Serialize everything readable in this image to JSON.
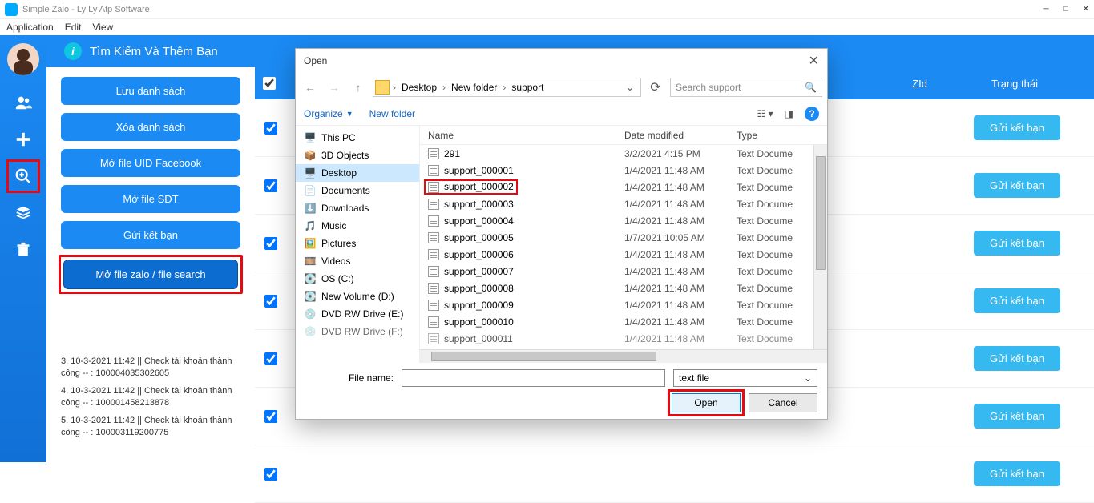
{
  "window": {
    "title": "Simple Zalo - Ly Ly Atp Software",
    "menu": {
      "application": "Application",
      "edit": "Edit",
      "view": "View"
    }
  },
  "banner": {
    "title": "Tìm Kiếm Và Thêm Bạn"
  },
  "buttons": {
    "save_list": "Lưu danh sách",
    "delete_list": "Xóa danh sách",
    "open_uid_fb": "Mở file UID Facebook",
    "open_sdt": "Mở file SĐT",
    "send_friend": "Gửi kết bạn",
    "open_file_search": "Mở file zalo / file search"
  },
  "log": {
    "e1": "3. 10-3-2021  11:42 || Check tài khoản thành công  -- : 100004035302605",
    "e2": "4. 10-3-2021  11:42 || Check tài khoản thành công  -- : 100001458213878",
    "e3": "5. 10-3-2021  11:42 || Check tài khoản thành công  -- : 100003119200775"
  },
  "table": {
    "col_zid": "ZId",
    "col_status": "Trạng thái",
    "action": "Gửi kết bạn"
  },
  "dialog": {
    "title": "Open",
    "crumbs": {
      "c1": "Desktop",
      "c2": "New folder",
      "c3": "support"
    },
    "search_placeholder": "Search support",
    "organize": "Organize",
    "new_folder": "New folder",
    "tree": {
      "this_pc": "This PC",
      "objects3d": "3D Objects",
      "desktop": "Desktop",
      "documents": "Documents",
      "downloads": "Downloads",
      "music": "Music",
      "pictures": "Pictures",
      "videos": "Videos",
      "os_c": "OS (C:)",
      "new_vol": "New Volume (D:)",
      "dvd_e": "DVD RW Drive (E:)",
      "dvd_f": "DVD RW Drive (F:)"
    },
    "cols": {
      "name": "Name",
      "date": "Date modified",
      "type": "Type"
    },
    "files": {
      "f0": {
        "n": "291",
        "d": "3/2/2021 4:15 PM",
        "t": "Text Docume"
      },
      "f1": {
        "n": "support_000001",
        "d": "1/4/2021 11:48 AM",
        "t": "Text Docume"
      },
      "f2": {
        "n": "support_000002",
        "d": "1/4/2021 11:48 AM",
        "t": "Text Docume"
      },
      "f3": {
        "n": "support_000003",
        "d": "1/4/2021 11:48 AM",
        "t": "Text Docume"
      },
      "f4": {
        "n": "support_000004",
        "d": "1/4/2021 11:48 AM",
        "t": "Text Docume"
      },
      "f5": {
        "n": "support_000005",
        "d": "1/7/2021 10:05 AM",
        "t": "Text Docume"
      },
      "f6": {
        "n": "support_000006",
        "d": "1/4/2021 11:48 AM",
        "t": "Text Docume"
      },
      "f7": {
        "n": "support_000007",
        "d": "1/4/2021 11:48 AM",
        "t": "Text Docume"
      },
      "f8": {
        "n": "support_000008",
        "d": "1/4/2021 11:48 AM",
        "t": "Text Docume"
      },
      "f9": {
        "n": "support_000009",
        "d": "1/4/2021 11:48 AM",
        "t": "Text Docume"
      },
      "f10": {
        "n": "support_000010",
        "d": "1/4/2021 11:48 AM",
        "t": "Text Docume"
      },
      "f11": {
        "n": "support_000011",
        "d": "1/4/2021 11:48 AM",
        "t": "Text Docume"
      }
    },
    "file_name_label": "File name:",
    "filter": "text file",
    "open": "Open",
    "cancel": "Cancel"
  }
}
